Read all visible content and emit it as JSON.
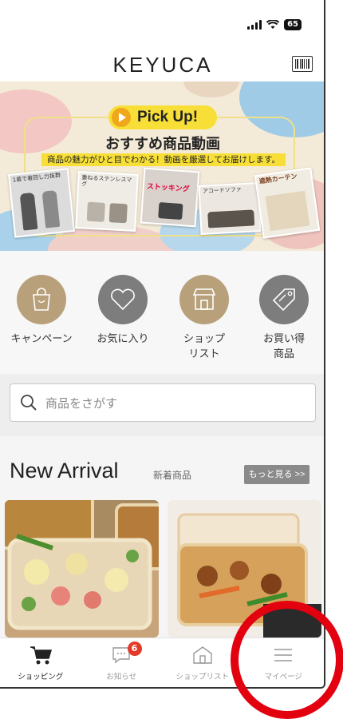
{
  "status": {
    "battery": "65"
  },
  "header": {
    "logo": "KEYUCA",
    "barcode_icon": "barcode-icon"
  },
  "banner": {
    "pick_label": "Pick Up!",
    "title": "おすすめ商品動画",
    "subtitle": "商品の魅力がひと目でわかる！動画を厳選してお届けします。",
    "thumbs": [
      {
        "caption": "1着で着回し力抜群"
      },
      {
        "caption": "重ねるステンレスマグ"
      },
      {
        "caption": "ストッキング"
      },
      {
        "caption": "アコードソファ"
      },
      {
        "caption": "遮熱カーテン"
      }
    ]
  },
  "categories": [
    {
      "label": "キャンペーン",
      "icon": "shopping-bag-icon",
      "color": "#b7a07a"
    },
    {
      "label": "お気に入り",
      "icon": "heart-icon",
      "color": "#7d7d7d"
    },
    {
      "label": "ショップ\nリスト",
      "icon": "shop-icon",
      "color": "#b7a07a"
    },
    {
      "label": "お買い得\n商品",
      "icon": "price-tag-icon",
      "color": "#7d7d7d"
    }
  ],
  "search": {
    "placeholder": "商品をさがす"
  },
  "new_arrival": {
    "title": "New Arrival",
    "subtitle": "新着商品",
    "more_label": "もっと見る >>"
  },
  "tabbar": {
    "items": [
      {
        "label": "ショッピング",
        "icon": "cart-icon"
      },
      {
        "label": "お知らせ",
        "icon": "message-icon",
        "badge": "6"
      },
      {
        "label": "ショップリスト",
        "icon": "shop-icon"
      },
      {
        "label": "マイページ",
        "icon": "menu-icon"
      }
    ]
  },
  "colors": {
    "accent_yellow": "#f7df37",
    "badge_red": "#e23b2a",
    "highlight_ring": "#e3000f"
  }
}
